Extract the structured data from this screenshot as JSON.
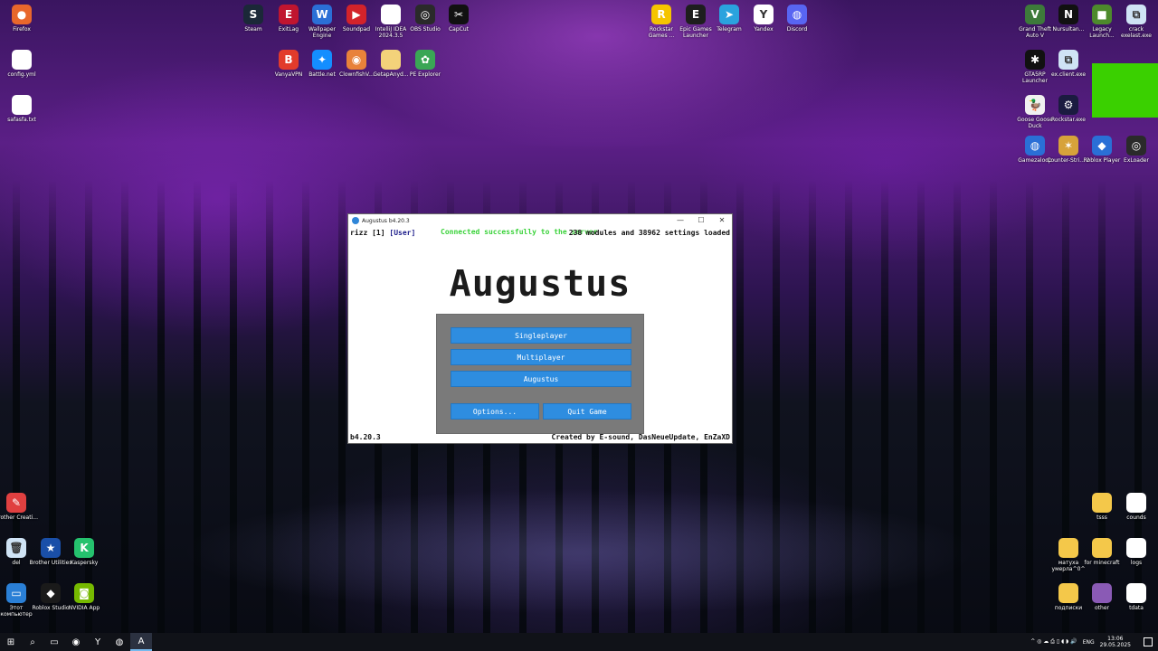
{
  "desktop_icons_top": [
    {
      "label": "Firefox",
      "color": "#e8672c",
      "glyph": "●"
    },
    {
      "label": "config.yml",
      "color": "#ffffff",
      "glyph": ""
    },
    {
      "label": "safasfa.txt",
      "color": "#ffffff",
      "glyph": ""
    },
    {
      "label": "Steam",
      "color": "#1b2838",
      "glyph": "S"
    },
    {
      "label": "ExitLag",
      "color": "#c0152f",
      "glyph": "E"
    },
    {
      "label": "Wallpaper Engine",
      "color": "#2b6fd6",
      "glyph": "W"
    },
    {
      "label": "Soundpad",
      "color": "#d3232a",
      "glyph": "▶"
    },
    {
      "label": "IntelliJ IDEA 2024.3.5",
      "color": "#ffffff",
      "glyph": ""
    },
    {
      "label": "OBS Studio",
      "color": "#2a2a2a",
      "glyph": "◎"
    },
    {
      "label": "CapCut",
      "color": "#111111",
      "glyph": "✂"
    },
    {
      "label": "VanyaVPN",
      "color": "#e23b2b",
      "glyph": "B"
    },
    {
      "label": "Battle.net",
      "color": "#148eff",
      "glyph": "✦"
    },
    {
      "label": "ClownfishV...",
      "color": "#e8823a",
      "glyph": "◉"
    },
    {
      "label": "GetapAnyd...",
      "color": "#f3d27a",
      "glyph": ""
    },
    {
      "label": "PE Explorer",
      "color": "#3aa655",
      "glyph": "✿"
    },
    {
      "label": "Rockstar Games ...",
      "color": "#f5c400",
      "glyph": "R"
    },
    {
      "label": "Epic Games Launcher",
      "color": "#1e1e1e",
      "glyph": "E"
    },
    {
      "label": "Telegram",
      "color": "#2aa3de",
      "glyph": "➤"
    },
    {
      "label": "Yandex",
      "color": "#ffffff",
      "glyph": "Y"
    },
    {
      "label": "Discord",
      "color": "#5865f2",
      "glyph": "◍"
    },
    {
      "label": "Grand Theft Auto V",
      "color": "#3d7a3a",
      "glyph": "V"
    },
    {
      "label": "Nursultan...",
      "color": "#111111",
      "glyph": "N"
    },
    {
      "label": "Legacy Launch...",
      "color": "#4d8a2c",
      "glyph": "■"
    },
    {
      "label": "crack exelast.exe",
      "color": "#cfe3f5",
      "glyph": "⧉"
    },
    {
      "label": "GTA5RP Launcher",
      "color": "#111111",
      "glyph": "✱"
    },
    {
      "label": "ex.client.exe",
      "color": "#cfe3f5",
      "glyph": "⧉"
    },
    {
      "label": "Goose Goose Duck",
      "color": "#f0f0f0",
      "glyph": "🦆"
    },
    {
      "label": "Rockstar.exe",
      "color": "#1b1b40",
      "glyph": "⚙"
    },
    {
      "label": "Gamezaloop",
      "color": "#2a6fd6",
      "glyph": "◍"
    },
    {
      "label": "Counter-Stri... 2",
      "color": "#d7a23a",
      "glyph": "✶"
    },
    {
      "label": "Roblox Player",
      "color": "#2a6fd6",
      "glyph": "◆"
    },
    {
      "label": "ExLoader",
      "color": "#2a2a2a",
      "glyph": "◎"
    }
  ],
  "desktop_icons_bottom": [
    {
      "label": "Brother Creati...",
      "color": "#e04040",
      "glyph": "✎"
    },
    {
      "label": "del",
      "color": "#cfe3f5",
      "glyph": "🗑"
    },
    {
      "label": "Brother Utilities",
      "color": "#1a4fa8",
      "glyph": "★"
    },
    {
      "label": "Kaspersky",
      "color": "#25c26e",
      "glyph": "K"
    },
    {
      "label": "Этот компьютер",
      "color": "#2a7fd6",
      "glyph": "▭"
    },
    {
      "label": "Roblox Studio",
      "color": "#1a1a1a",
      "glyph": "◆"
    },
    {
      "label": "NVIDIA App",
      "color": "#76b900",
      "glyph": "◙"
    },
    {
      "label": "tsss",
      "color": "#f4c84a",
      "glyph": ""
    },
    {
      "label": "counds",
      "color": "#ffffff",
      "glyph": ""
    },
    {
      "label": "матуха умерла^0^",
      "color": "#f4c84a",
      "glyph": ""
    },
    {
      "label": "for minecraft",
      "color": "#f4c84a",
      "glyph": ""
    },
    {
      "label": "logs",
      "color": "#ffffff",
      "glyph": ""
    },
    {
      "label": "подписки",
      "color": "#f4c84a",
      "glyph": ""
    },
    {
      "label": "other",
      "color": "#8a5ab5",
      "glyph": ""
    },
    {
      "label": "tdata",
      "color": "#ffffff",
      "glyph": ""
    }
  ],
  "window": {
    "title": "Augustus b4.20.3",
    "minimize": "—",
    "maximize": "☐",
    "close": "✕",
    "user_name": "rizz",
    "user_id": "[1]",
    "user_rank": "[User]",
    "connected": "Connected successfully to the server",
    "modules_status": "238 modules and 38962 settings loaded",
    "logo": "Augustus",
    "buttons": {
      "singleplayer": "Singleplayer",
      "multiplayer": "Multiplayer",
      "augustus": "Augustus",
      "options": "Options...",
      "quit": "Quit Game"
    },
    "version": "b4.20.3",
    "credits": "Created by E-sound, DasNeueUpdate, EnZaXD"
  },
  "taskbar": {
    "items": [
      "⊞",
      "⌕",
      "▭",
      "◉",
      "Y",
      "◍",
      "A"
    ],
    "tray_lang": "ENG",
    "time": "13:06",
    "date": "29.05.2025",
    "tray_icons": "^ ◎ ☁ ⎙ ▯ ◖ ◗ 🔊"
  }
}
